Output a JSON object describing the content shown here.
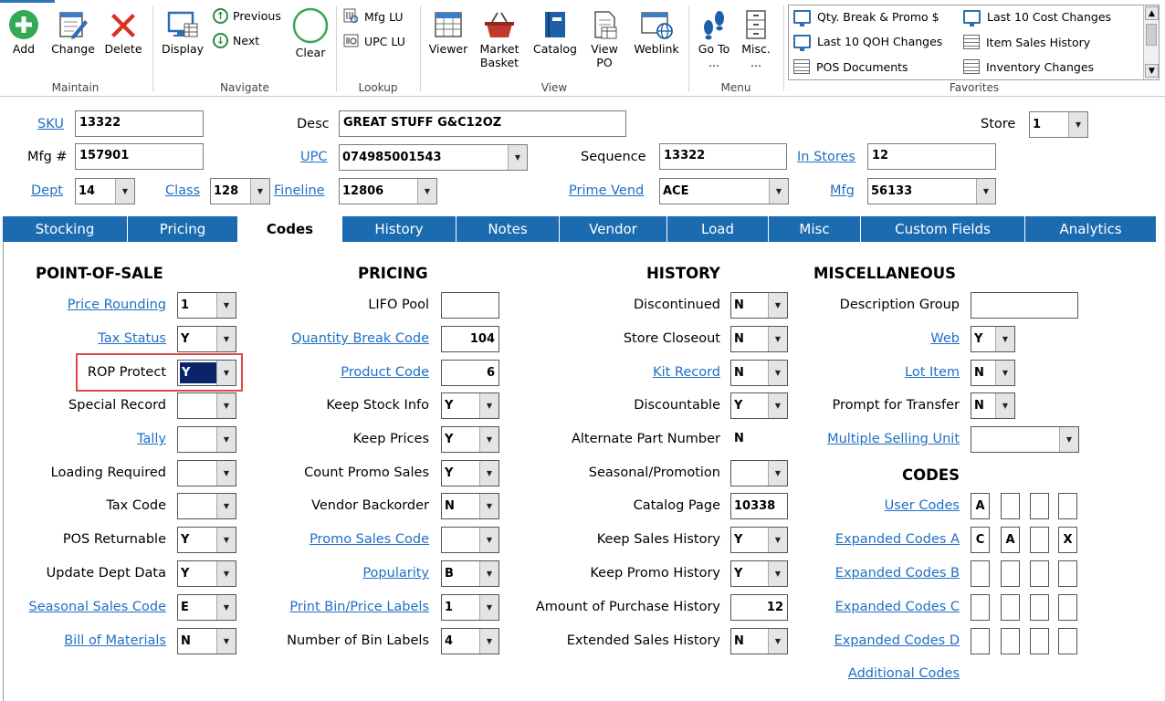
{
  "ribbon": {
    "maintain": {
      "label": "Maintain",
      "add": "Add",
      "change": "Change",
      "delete": "Delete"
    },
    "navigate": {
      "label": "Navigate",
      "display": "Display",
      "previous": "Previous",
      "next": "Next",
      "clear": "Clear"
    },
    "lookup": {
      "label": "Lookup",
      "mfg_lu": "Mfg LU",
      "upc_lu": "UPC LU"
    },
    "view": {
      "label": "View",
      "viewer": "Viewer",
      "market_basket_1": "Market",
      "market_basket_2": "Basket",
      "catalog": "Catalog",
      "view_po_1": "View",
      "view_po_2": "PO",
      "weblink": "Weblink"
    },
    "menu": {
      "label": "Menu",
      "go_to_1": "Go To",
      "go_to_2": "...",
      "misc_1": "Misc.",
      "misc_2": "..."
    },
    "favorites": {
      "label": "Favorites",
      "items": [
        "Qty. Break & Promo $",
        "Last 10 Cost Changes",
        "Last 10 QOH Changes",
        "Item Sales History",
        "POS Documents",
        "Inventory Changes"
      ]
    }
  },
  "header": {
    "sku_label": "SKU",
    "sku": "13322",
    "desc_label": "Desc",
    "desc": "GREAT STUFF G&C12OZ",
    "store_label": "Store",
    "store": "1",
    "mfg_no_label": "Mfg #",
    "mfg_no": "157901",
    "upc_label": "UPC",
    "upc": "074985001543",
    "sequence_label": "Sequence",
    "sequence": "13322",
    "in_stores_label": "In Stores",
    "in_stores": "12",
    "dept_label": "Dept",
    "dept": "14",
    "class_label": "Class",
    "class": "128",
    "fineline_label": "Fineline",
    "fineline": "12806",
    "prime_vend_label": "Prime Vend",
    "prime_vend": "ACE",
    "mfg_label": "Mfg",
    "mfg": "56133"
  },
  "tabs": [
    "Stocking",
    "Pricing",
    "Codes",
    "History",
    "Notes",
    "Vendor",
    "Load",
    "Misc",
    "Custom Fields",
    "Analytics"
  ],
  "active_tab": "Codes",
  "pos": {
    "title": "POINT-OF-SALE",
    "rows": [
      {
        "label": "Price Rounding",
        "value": "1"
      },
      {
        "label": "Tax Status",
        "value": "Y"
      },
      {
        "label": "ROP Protect",
        "value": "Y"
      },
      {
        "label": "Special Record",
        "value": ""
      },
      {
        "label": "Tally",
        "value": ""
      },
      {
        "label": "Loading Required",
        "value": ""
      },
      {
        "label": "Tax Code",
        "value": ""
      },
      {
        "label": "POS Returnable",
        "value": "Y"
      },
      {
        "label": "Update Dept Data",
        "value": "Y"
      },
      {
        "label": "Seasonal Sales Code",
        "value": "E"
      },
      {
        "label": "Bill of Materials",
        "value": "N"
      }
    ]
  },
  "pricing": {
    "title": "PRICING",
    "rows": [
      {
        "label": "LIFO Pool",
        "value": ""
      },
      {
        "label": "Quantity Break Code",
        "value": "104"
      },
      {
        "label": "Product Code",
        "value": "6"
      },
      {
        "label": "Keep Stock Info",
        "value": "Y"
      },
      {
        "label": "Keep Prices",
        "value": "Y"
      },
      {
        "label": "Count Promo Sales",
        "value": "Y"
      },
      {
        "label": "Vendor Backorder",
        "value": "N"
      },
      {
        "label": "Promo Sales Code",
        "value": ""
      },
      {
        "label": "Popularity",
        "value": "B"
      },
      {
        "label": "Print Bin/Price Labels",
        "value": "1"
      },
      {
        "label": "Number of Bin Labels",
        "value": "4"
      }
    ]
  },
  "history": {
    "title": "HISTORY",
    "rows": [
      {
        "label": "Discontinued",
        "value": "N"
      },
      {
        "label": "Store Closeout",
        "value": "N"
      },
      {
        "label": "Kit Record",
        "value": "N"
      },
      {
        "label": "Discountable",
        "value": "Y"
      },
      {
        "label": "Alternate Part Number",
        "value": "N"
      },
      {
        "label": "Seasonal/Promotion",
        "value": ""
      },
      {
        "label": "Catalog Page",
        "value": "10338"
      },
      {
        "label": "Keep Sales History",
        "value": "Y"
      },
      {
        "label": "Keep Promo History",
        "value": "Y"
      },
      {
        "label": "Amount of Purchase History",
        "value": "12"
      },
      {
        "label": "Extended Sales History",
        "value": "N"
      }
    ]
  },
  "misc": {
    "title": "MISCELLANEOUS",
    "rows": [
      {
        "label": "Description Group",
        "value": ""
      },
      {
        "label": "Web",
        "value": "Y"
      },
      {
        "label": "Lot Item",
        "value": "N"
      },
      {
        "label": "Prompt for Transfer",
        "value": "N"
      },
      {
        "label": "Multiple Selling Unit",
        "value": ""
      }
    ]
  },
  "codes": {
    "title": "CODES",
    "rows": [
      {
        "label": "User Codes",
        "values": [
          "A",
          "",
          "",
          ""
        ]
      },
      {
        "label": "Expanded Codes A",
        "values": [
          "C",
          "A",
          "",
          "X"
        ]
      },
      {
        "label": "Expanded Codes B",
        "values": [
          "",
          "",
          "",
          ""
        ]
      },
      {
        "label": "Expanded Codes C",
        "values": [
          "",
          "",
          "",
          ""
        ]
      },
      {
        "label": "Expanded Codes D",
        "values": [
          "",
          "",
          "",
          ""
        ]
      }
    ],
    "additional": "Additional Codes"
  }
}
